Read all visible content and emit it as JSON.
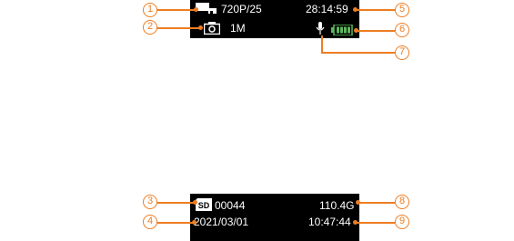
{
  "top_bar": {
    "video_resolution": "720P/25",
    "recording_time": "28:14:59",
    "photo_resolution": "1M"
  },
  "bottom_bar": {
    "file_count": "00044",
    "remaining_storage": "110.4G",
    "date": "2021/03/01",
    "time": "10:47:44"
  },
  "icons": {
    "video": "video-camera-icon",
    "photo": "camera-icon",
    "microphone": "microphone-icon",
    "battery": "battery-icon",
    "sd_card": "sd-card-icon",
    "sd_label": "SD"
  },
  "callouts": [
    "1",
    "2",
    "3",
    "4",
    "5",
    "6",
    "7",
    "8",
    "9"
  ],
  "colors": {
    "callout": "#ee7d22",
    "battery": "#5cb85c",
    "screen_bars": "#000000"
  }
}
